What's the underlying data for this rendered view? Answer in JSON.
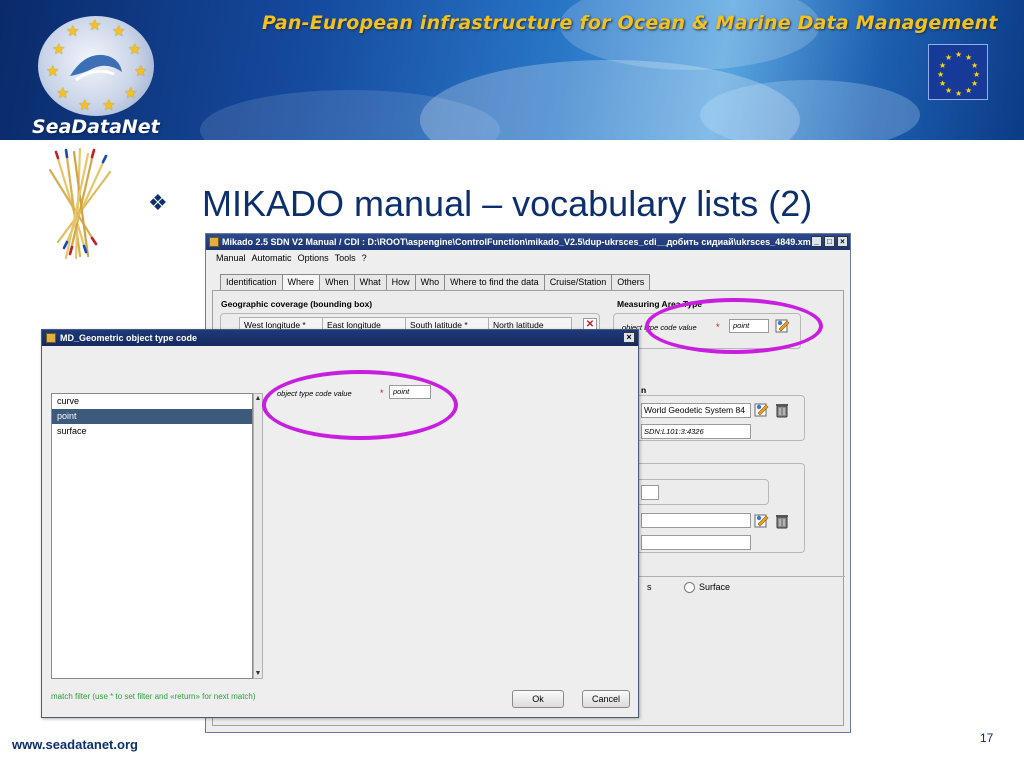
{
  "banner": {
    "title": "Pan-European infrastructure for Ocean & Marine Data Management",
    "logo_text": "SeaDataNet",
    "logo_icon": "seadatanet-logo-icon",
    "flag_icon": "eu-flag-icon"
  },
  "slide": {
    "bullet": "❖",
    "title": "MIKADO manual – vocabulary lists (2)",
    "footer_url": "www.seadatanet.org",
    "page_number": "17",
    "accent_color": "#0d2f6c",
    "annotation_color": "#c81ee0"
  },
  "main_window": {
    "title": "Mikado 2.5  SDN V2    Manual / CDI : D:\\ROOT\\aspengine\\ControlFunction\\mikado_V2.5\\dup-ukrsces_cdi__добить сидиай\\ukrsces_4849.xml",
    "menu": [
      "Manual",
      "Automatic",
      "Options",
      "Tools",
      "?"
    ],
    "tabs": [
      "Identification",
      "Where",
      "When",
      "What",
      "How",
      "Who",
      "Where to find the data",
      "Cruise/Station",
      "Others"
    ],
    "active_tab": "Where",
    "geo_coverage_label": "Geographic coverage (bounding box)",
    "geo_columns": [
      "West longitude *",
      "East longitude",
      "South latitude *",
      "North latitude"
    ],
    "measuring_area_label": "Measuring Area Type",
    "area_field_label": "object type code value",
    "area_field_required": "*",
    "area_field_value": "point",
    "crs_label_fragment": "n",
    "crs_value": "World Geodetic System 84",
    "crs_code": "SDN:L101:3:4326",
    "radio_fragment": "s",
    "radio_surface_label": "Surface"
  },
  "dialog": {
    "title": "MD_Geometric object type code",
    "list_items": [
      "curve",
      "point",
      "surface"
    ],
    "selected_item": "point",
    "field_label": "object type code value",
    "field_required": "*",
    "field_value": "point",
    "hint": "match filter (use *  to set filter and «return» for next match)",
    "ok_label": "Ok",
    "cancel_label": "Cancel"
  }
}
